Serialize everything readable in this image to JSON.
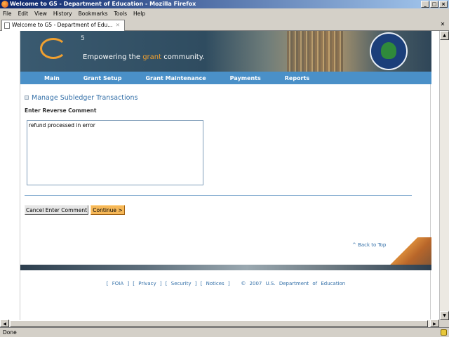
{
  "window": {
    "title": "Welcome to G5 - Department of Education - Mozilla Firefox"
  },
  "menu": [
    "File",
    "Edit",
    "View",
    "History",
    "Bookmarks",
    "Tools",
    "Help"
  ],
  "tab": {
    "label": "Welcome to G5 - Department of Edu..."
  },
  "banner": {
    "logo_super": "5",
    "tagline_pre": "Empowering the ",
    "tagline_grant": "grant",
    "tagline_post": " community."
  },
  "nav": [
    "Main",
    "Grant Setup",
    "Grant Maintenance",
    "Payments",
    "Reports"
  ],
  "page": {
    "heading": "Manage Subledger Transactions",
    "field_label": "Enter Reverse Comment",
    "comment_value": "refund processed in error",
    "cancel_label": "Cancel Enter Comment",
    "continue_label": "Continue >",
    "back_to_top": "^ Back to Top"
  },
  "footer": {
    "foia": "FOIA",
    "privacy": "Privacy",
    "security": "Security",
    "notices": "Notices",
    "copyright": "© 2007 U.S. Department of Education"
  },
  "status": {
    "text": "Done"
  },
  "colors": {
    "nav": "#4a90c8",
    "accent": "#f0a030",
    "link": "#3470a8"
  }
}
